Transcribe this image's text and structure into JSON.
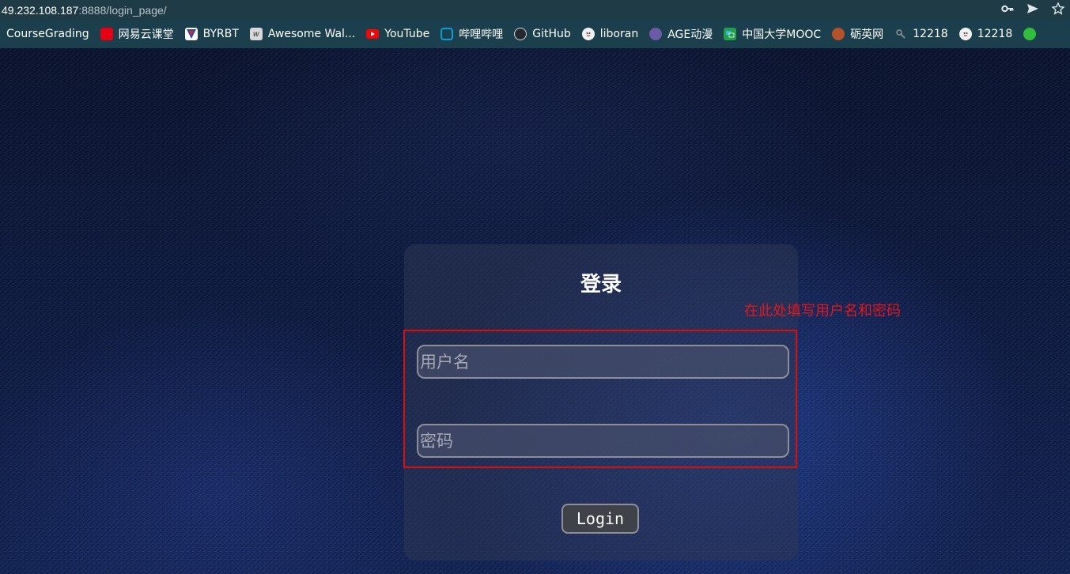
{
  "browser": {
    "url_host": "49.232.108.187",
    "url_rest": ":8888/login_page/",
    "icons": [
      "key-icon",
      "send-icon",
      "star-icon"
    ]
  },
  "bookmarks": [
    {
      "label": "CourseGrading",
      "icon": "",
      "color": ""
    },
    {
      "label": "网易云课堂",
      "icon": "netease-study-icon",
      "color": "#e60012"
    },
    {
      "label": "BYRBT",
      "icon": "byrbt-icon",
      "color": "#2a4aa0"
    },
    {
      "label": "Awesome Wal...",
      "icon": "wallpaper-icon",
      "color": "#d8d8d8"
    },
    {
      "label": "YouTube",
      "icon": "youtube-icon",
      "color": "#ff0000"
    },
    {
      "label": "哔哩哔哩",
      "icon": "bilibili-icon",
      "color": "#00a1d6"
    },
    {
      "label": "GitHub",
      "icon": "github-icon",
      "color": "#24292e"
    },
    {
      "label": "liboran",
      "icon": "avatar-icon",
      "color": "#f0f0f0"
    },
    {
      "label": "AGE动漫",
      "icon": "age-anime-icon",
      "color": "#6b5aa6"
    },
    {
      "label": "中国大学MOOC",
      "icon": "mooc-icon",
      "color": "#20a04a"
    },
    {
      "label": "砺英网",
      "icon": "liying-icon",
      "color": "#b5522a"
    },
    {
      "label": "12218",
      "icon": "bookmark-icon",
      "color": "#555a5e"
    },
    {
      "label": "12218",
      "icon": "avatar-icon",
      "color": "#f0f0f0"
    }
  ],
  "login": {
    "title": "登录",
    "username_placeholder": "用户名",
    "password_placeholder": "密码",
    "button": "Login"
  },
  "annotation": {
    "text": "在此处填写用户名和密码",
    "color": "#e3161a"
  }
}
